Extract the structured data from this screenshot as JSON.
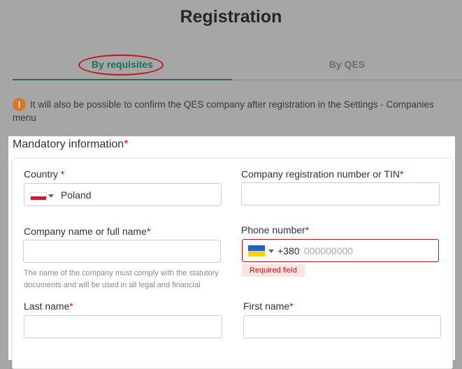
{
  "page": {
    "title": "Registration"
  },
  "tabs": [
    {
      "label": "By requisites",
      "active": true
    },
    {
      "label": "By QES",
      "active": false
    }
  ],
  "notice": {
    "icon": "exclamation-icon",
    "text": "It will also be possible to confirm the QES company after registration in the Settings - Companies menu"
  },
  "section": {
    "title": "Mandatory information",
    "required_mark": "*"
  },
  "fields": {
    "country": {
      "label": "Country ",
      "required_mark": "*",
      "value": "Poland",
      "flag": "poland-flag-icon"
    },
    "tin": {
      "label": "Company registration number or TIN",
      "required_mark": "*",
      "value": ""
    },
    "company_name": {
      "label": "Company name or full name",
      "required_mark": "*",
      "value": "",
      "hint": "The name of the company must comply with the statutory documents and will be used in all legal and financial"
    },
    "phone": {
      "label": "Phone number",
      "required_mark": "*",
      "dial_code": "+380",
      "placeholder": "000000000",
      "flag": "ukraine-flag-icon",
      "error": "Required field"
    },
    "last_name": {
      "label": "Last name",
      "required_mark": "*",
      "value": ""
    },
    "first_name": {
      "label": "First name",
      "required_mark": "*",
      "value": ""
    }
  },
  "colors": {
    "accent": "#1f6f5c",
    "error": "#c0171d",
    "warning": "#d97928",
    "overlay": "#a6a6a6"
  }
}
